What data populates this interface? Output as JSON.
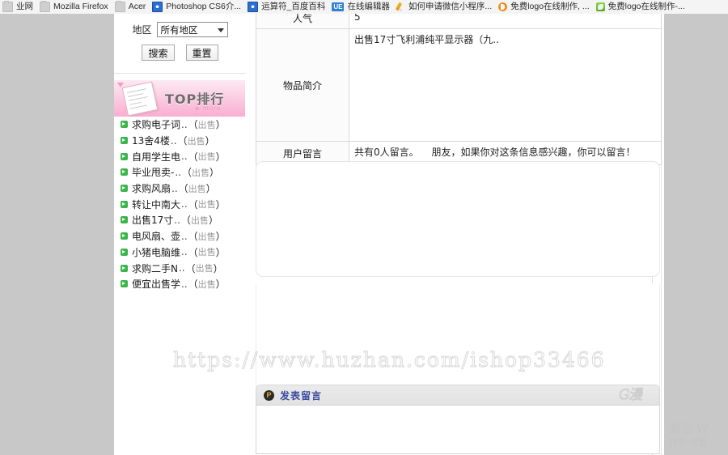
{
  "taskbar": {
    "items": [
      {
        "label": "业网",
        "icon": "window-icon",
        "truncated": false
      },
      {
        "label": "Mozilla Firefox",
        "icon": "folder-icon",
        "truncated": false
      },
      {
        "label": "Acer",
        "icon": "folder-icon",
        "truncated": false
      },
      {
        "label": "Photoshop CS6介...",
        "icon": "blue-app-icon",
        "truncated": true
      },
      {
        "label": "运算符_百度百科",
        "icon": "baidu-icon",
        "truncated": false
      },
      {
        "label": "在线编辑器",
        "icon": "ue-icon",
        "truncated": false
      },
      {
        "label": "如何申请微信小程序...",
        "icon": "pencil-icon",
        "truncated": true
      },
      {
        "label": "免费logo在线制作, ...",
        "icon": "orange-circle-icon",
        "truncated": true
      },
      {
        "label": "免费logo在线制作-...",
        "icon": "green-leaf-icon",
        "truncated": true
      }
    ]
  },
  "sidebar": {
    "search": {
      "region_label": "地区",
      "region_value": "所有地区",
      "search_button": "搜索",
      "reset_button": "重置"
    },
    "top_panel": {
      "title": "TOP排行",
      "more_label": "more"
    },
    "rank_items": [
      {
        "title": "求购电子词",
        "dots": "..",
        "tag": "出售"
      },
      {
        "title": "13舍4楼",
        "dots": "..",
        "tag": "出售"
      },
      {
        "title": "自用学生电",
        "dots": "..",
        "tag": "出售"
      },
      {
        "title": "毕业甩卖-",
        "dots": "..",
        "tag": "出售"
      },
      {
        "title": "求购风扇",
        "dots": "..",
        "tag": "出售"
      },
      {
        "title": "转让中南大",
        "dots": "..",
        "tag": "出售"
      },
      {
        "title": "出售17寸",
        "dots": "..",
        "tag": "出售"
      },
      {
        "title": "电风扇、壶",
        "dots": "..",
        "tag": "出售"
      },
      {
        "title": "小猪电脑维",
        "dots": "..",
        "tag": "出售"
      },
      {
        "title": "求购二手N",
        "dots": "..",
        "tag": "出售"
      },
      {
        "title": "便宜出售学",
        "dots": "..",
        "tag": "出售"
      }
    ]
  },
  "main": {
    "table": {
      "popularity_label": "人气",
      "popularity_value": "5",
      "description_label": "物品简介",
      "description_value": "出售17寸飞利浦纯平显示器（九..",
      "messages_label": "用户留言",
      "messages_count_text": "共有0人留言。",
      "messages_hint": "朋友，如果你对这条信息感兴趣，你可以留言！"
    },
    "post": {
      "title": "发表留言",
      "icon_glyph": "P",
      "deco_text": "G漫"
    }
  },
  "watermark": {
    "url": "https://www.huzhan.com/ishop33466"
  },
  "activation": {
    "line1": "激活 W",
    "line2": "转到 设置"
  },
  "colors": {
    "page_background": "#ffffff",
    "gutter": "#c8c8c8",
    "banner_pink": "#f9aed0",
    "bullet_green": "#3cb54a",
    "post_title_blue": "#3b4a9e",
    "tag_gray": "#9a9a9a",
    "watermark_gray": "#d9d9d9"
  }
}
